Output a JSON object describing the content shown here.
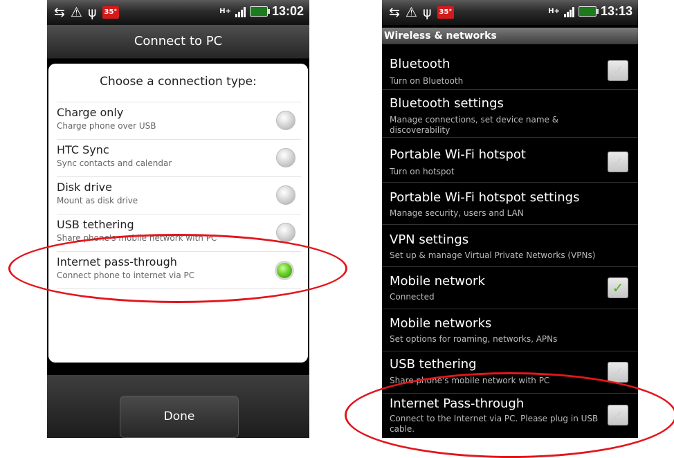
{
  "left": {
    "status": {
      "temperature": "35°",
      "network": "H+",
      "time": "13:02"
    },
    "title": "Connect to PC",
    "dialog_heading": "Choose a connection type:",
    "options": [
      {
        "title": "Charge only",
        "subtitle": "Charge phone over USB",
        "selected": false
      },
      {
        "title": "HTC Sync",
        "subtitle": "Sync contacts and calendar",
        "selected": false
      },
      {
        "title": "Disk drive",
        "subtitle": "Mount as disk drive",
        "selected": false
      },
      {
        "title": "USB tethering",
        "subtitle": "Share phone's mobile network with PC",
        "selected": false
      },
      {
        "title": "Internet pass-through",
        "subtitle": "Connect phone to internet via PC",
        "selected": true
      }
    ],
    "done_label": "Done"
  },
  "right": {
    "status": {
      "temperature": "35°",
      "network": "H+",
      "time": "13:13"
    },
    "section_header": "Wireless & networks",
    "settings": [
      {
        "title": "Bluetooth",
        "subtitle": "Turn on Bluetooth",
        "checkbox": "unchecked"
      },
      {
        "title": "Bluetooth settings",
        "subtitle": "Manage connections, set device name & discoverability",
        "checkbox": "none"
      },
      {
        "title": "Portable Wi-Fi hotspot",
        "subtitle": "Turn on hotspot",
        "checkbox": "unchecked"
      },
      {
        "title": "Portable Wi-Fi hotspot settings",
        "subtitle": "Manage security, users and LAN",
        "checkbox": "none"
      },
      {
        "title": "VPN settings",
        "subtitle": "Set up & manage Virtual Private Networks (VPNs)",
        "checkbox": "none"
      },
      {
        "title": "Mobile network",
        "subtitle": "Connected",
        "checkbox": "checked"
      },
      {
        "title": "Mobile networks",
        "subtitle": "Set options for roaming, networks, APNs",
        "checkbox": "none"
      },
      {
        "title": "USB tethering",
        "subtitle": "Share phone's mobile network with PC",
        "checkbox": "unchecked"
      },
      {
        "title": "Internet Pass-through",
        "subtitle": "Connect to the Internet via PC. Please plug in USB cable.",
        "checkbox": "unchecked"
      }
    ]
  },
  "icons": [
    "sync-icon",
    "warning-icon",
    "usb-icon",
    "signal-icon",
    "battery-icon",
    "check-icon"
  ],
  "colors": {
    "highlight_ring": "#e2161c",
    "radio_selected": "#6bcf2a",
    "check_mark": "#48b514",
    "temp_badge": "#d41b1b"
  }
}
